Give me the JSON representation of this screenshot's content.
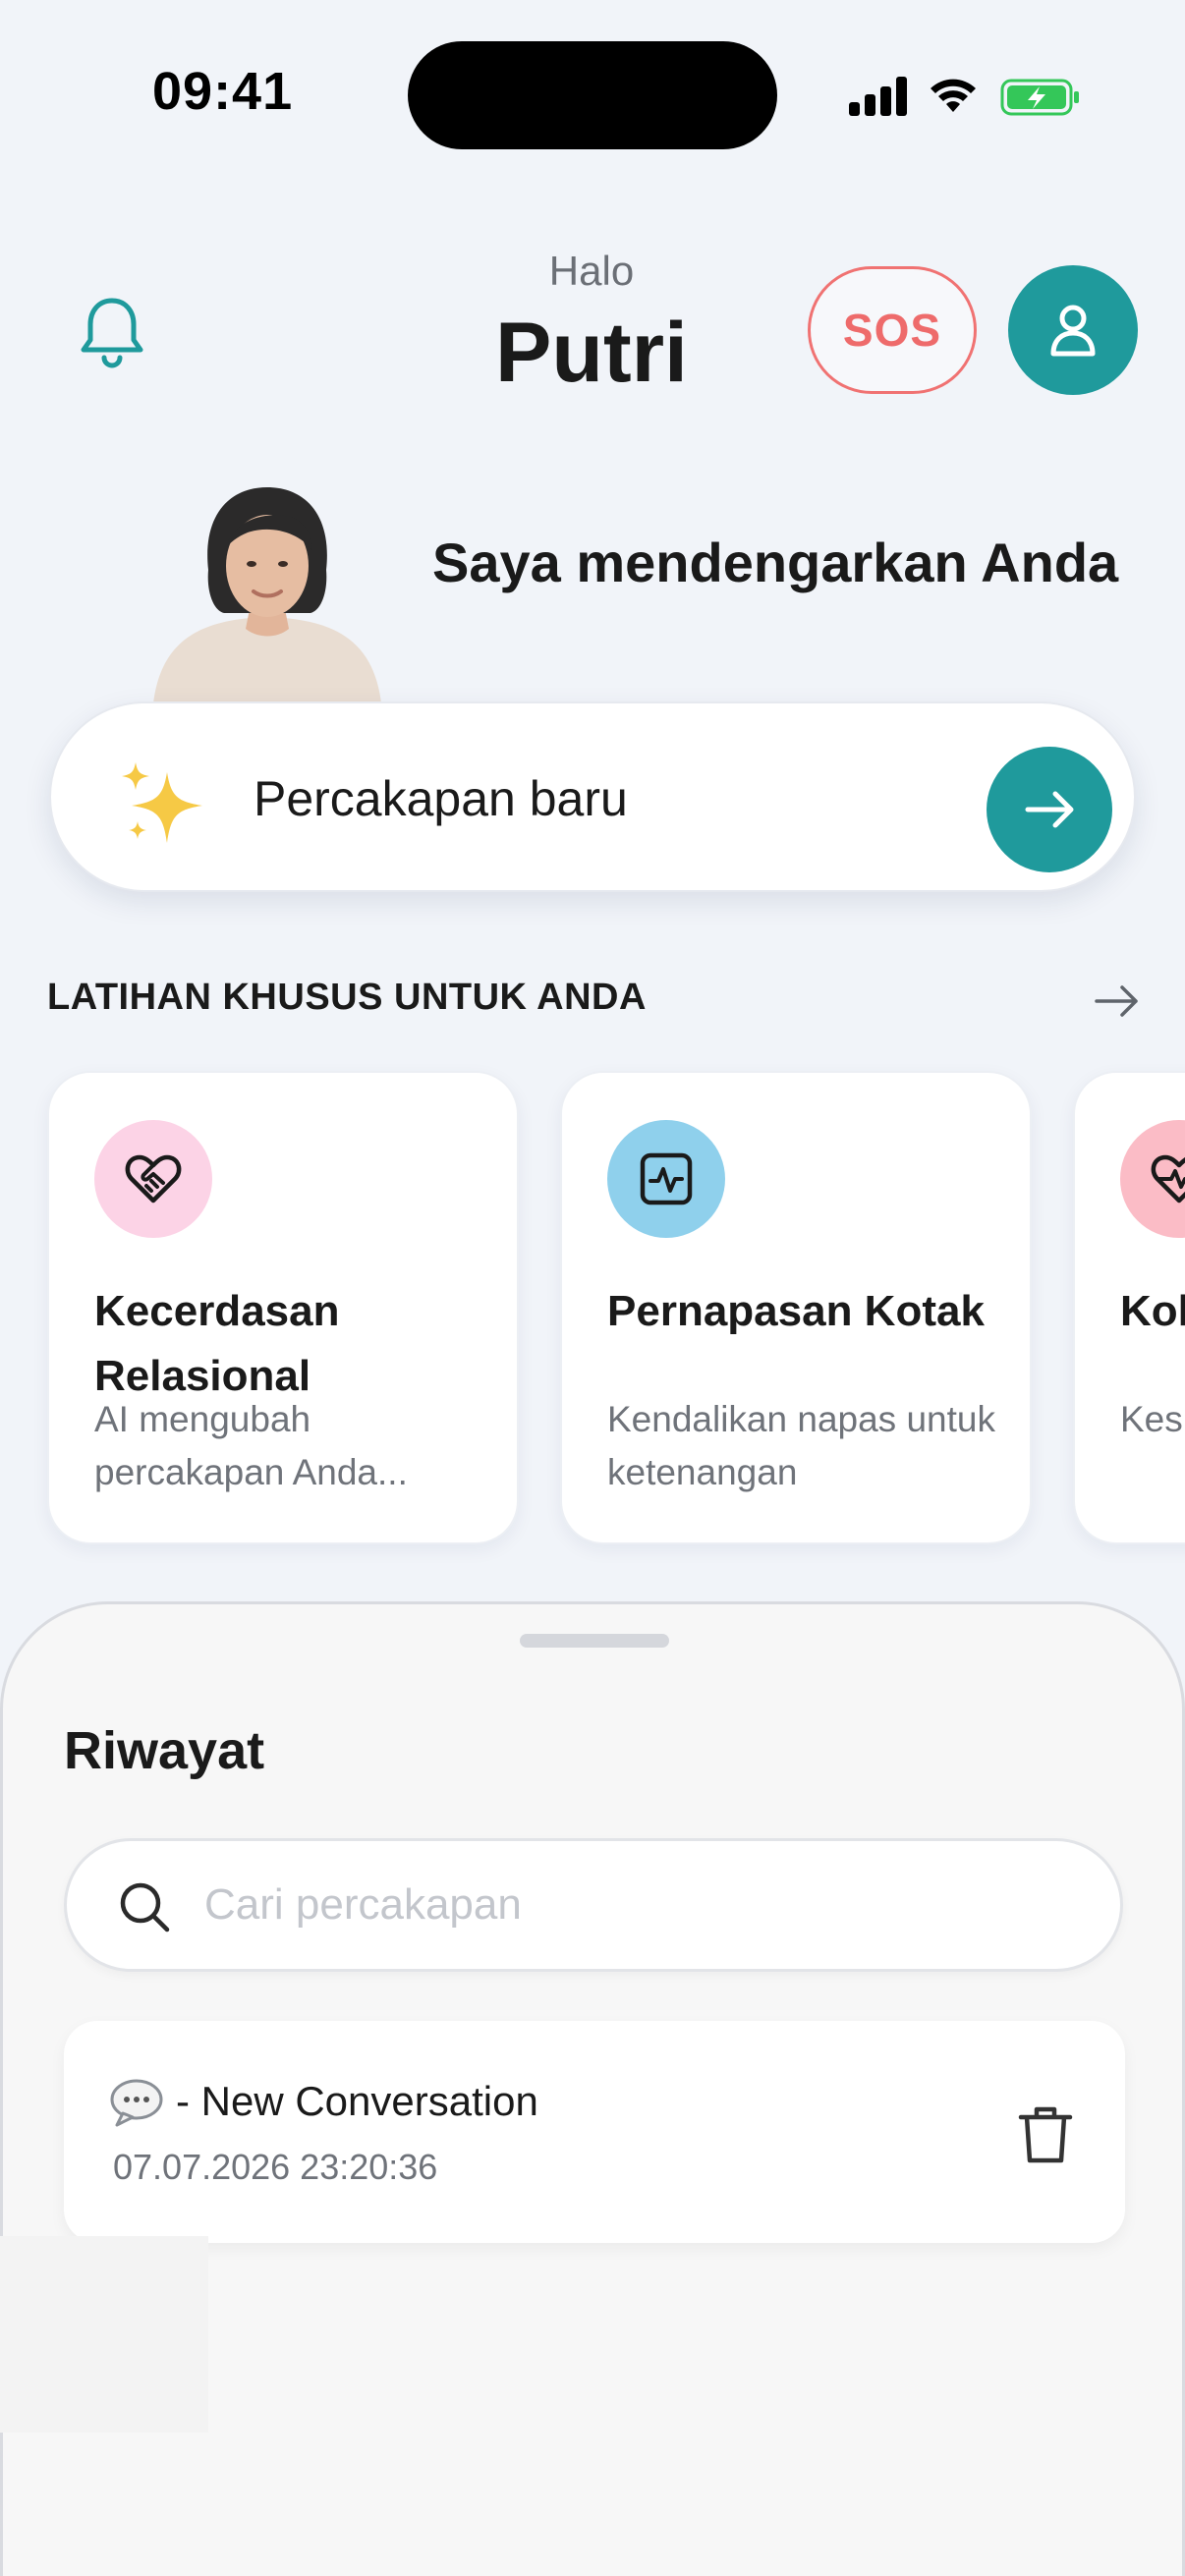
{
  "status_bar": {
    "time": "09:41",
    "icons": [
      "cellular-signal-icon",
      "wifi-icon",
      "battery-charging-icon"
    ],
    "battery_color": "#34c759"
  },
  "header": {
    "greeting": "Halo",
    "name": "Putri",
    "sos_label": "SOS",
    "icons": [
      "bell-icon",
      "user-icon"
    ]
  },
  "hero": {
    "tagline": "Saya mendengarkan Anda"
  },
  "new_chat": {
    "label": "Percakapan baru",
    "icons": [
      "sparkles-icon",
      "arrow-right-icon"
    ]
  },
  "exercises": {
    "section_title": "LATIHAN KHUSUS UNTUK ANDA",
    "items": [
      {
        "title": "Kecerdasan Relasional",
        "description": "AI mengubah percakapan Anda...",
        "icon": "heart-handshake-icon",
        "icon_bg": "#fcd3e6"
      },
      {
        "title": "Pernapasan Kotak",
        "description": "Kendalikan napas untuk ketenangan",
        "icon": "activity-square-icon",
        "icon_bg": "#8fd0ec"
      },
      {
        "title": "Koh Jan",
        "description": "Kes jant",
        "icon": "heart-pulse-icon",
        "icon_bg": "#fbbcc6"
      }
    ]
  },
  "history": {
    "title": "Riwayat",
    "search_placeholder": "Cari percakapan",
    "items": [
      {
        "title": "- New Conversation",
        "date": "07.07.2026 23:20:36",
        "icon": "speech-bubble-icon"
      }
    ]
  },
  "colors": {
    "accent_teal": "#1f9a9c",
    "sos_red": "#ee6b6b",
    "background": "#f1f4f9"
  }
}
